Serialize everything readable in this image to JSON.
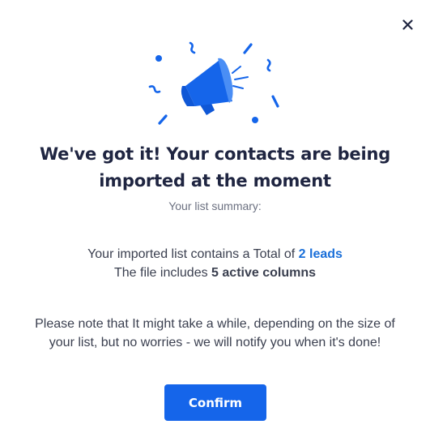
{
  "dialog": {
    "close_icon": "close-icon",
    "illustration_icon": "megaphone-icon",
    "title": "We've got it! Your contacts are being imported at the moment",
    "subtitle": "Your list summary:",
    "summary": {
      "line1_prefix": "Your imported list contains a Total of ",
      "leads_count": "2 leads",
      "line2_prefix": "The file includes ",
      "columns_count": "5 active columns"
    },
    "note": "Please note that It might take a while, depending on the size of your list, but no worries - we will notify you when it's done!",
    "confirm_label": "Confirm"
  },
  "colors": {
    "accent": "#1565ea",
    "highlight": "#1a6fd9",
    "title": "#1f2541",
    "text": "#3a3f4f",
    "muted": "#6b7080"
  }
}
